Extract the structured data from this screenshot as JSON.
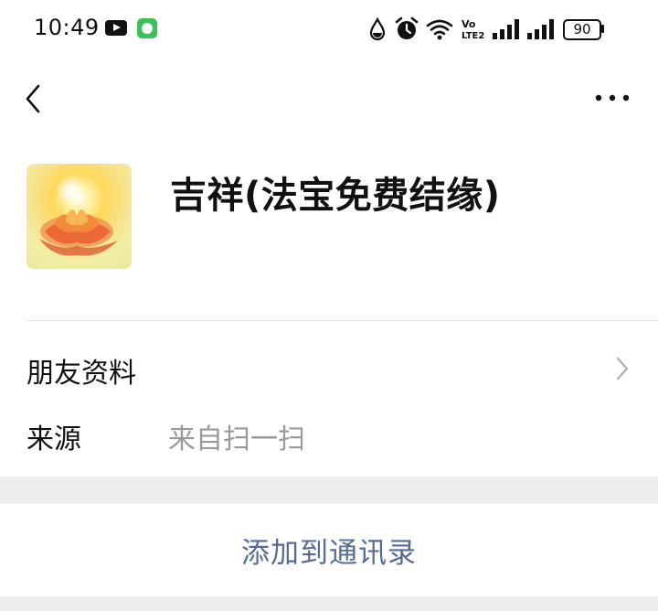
{
  "status_bar": {
    "time": "10:49",
    "battery": "90",
    "icons": [
      "youtube-icon",
      "vpn-icon",
      "water-drop-icon",
      "alarm-icon",
      "wifi-icon",
      "volte-icon",
      "signal-icon",
      "signal-icon",
      "battery-icon"
    ]
  },
  "nav": {
    "back_icon": "back-arrow-icon",
    "more_icon": "more-icon"
  },
  "profile": {
    "avatar_icon": "lotus-avatar",
    "name": "吉祥(法宝免费结缘)"
  },
  "rows": {
    "friend_info": "朋友资料",
    "source_label": "来源",
    "source_value": "来自扫一扫"
  },
  "actions": {
    "add_to_contacts": "添加到通讯录"
  },
  "colors": {
    "accent": "#576b95",
    "background": "#ededed",
    "card": "#ffffff"
  }
}
